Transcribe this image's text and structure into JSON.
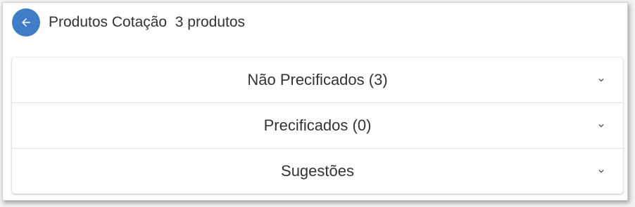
{
  "header": {
    "back_icon": "arrow-left-icon",
    "title": "Produtos Cotação  3 produtos"
  },
  "panels": [
    {
      "label": "Não Precificados (3)",
      "icon": "chevron-down-icon"
    },
    {
      "label": "Precificados (0)",
      "icon": "chevron-down-icon"
    },
    {
      "label": "Sugestões",
      "icon": "chevron-down-icon"
    }
  ],
  "colors": {
    "accent": "#3f7dc9",
    "text": "#333333"
  }
}
